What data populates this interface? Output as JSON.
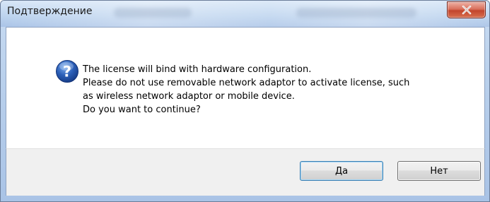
{
  "dialog": {
    "title": "Подтверждение",
    "message_lines": [
      "The license will bind with hardware configuration.",
      "Please do not use removable network adaptor to activate license, such",
      "as wireless network adaptor or mobile device.",
      "Do you want to continue?"
    ],
    "icon": "question-icon",
    "buttons": {
      "yes_label": "Да",
      "no_label": "Нет"
    }
  },
  "titlebar": {
    "close_icon": "close-icon"
  },
  "colors": {
    "close_button": "#c2452d",
    "icon_blue": "#2b5fb8",
    "footer_bg": "#f0f0f0",
    "titlebar_bg": "#bcd3ee"
  }
}
